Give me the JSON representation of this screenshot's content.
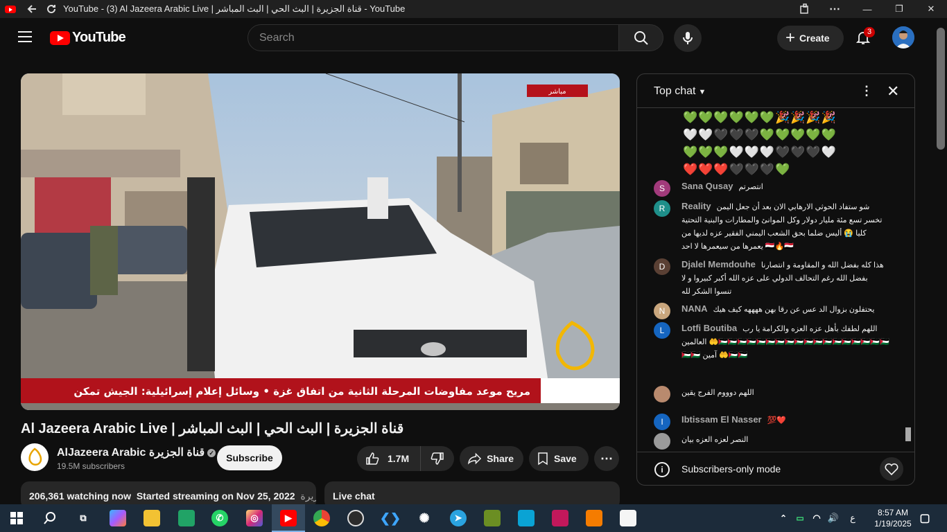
{
  "window": {
    "title": "YouTube - (3) Al Jazeera Arabic Live | قناة الجزيرة | البث الحي | البث المباشر - YouTube"
  },
  "masthead": {
    "logo_text": "YouTube",
    "search_placeholder": "Search",
    "create_label": "Create",
    "notification_count": "3"
  },
  "video": {
    "title": "Al Jazeera Arabic Live | قناة الجزيرة | البث الحي | البث المباشر",
    "ticker_text": "مريح موعد مفاوضات المرحلة الثانية من اتفاق غزة  •  وسائل إعلام إسرائيلية: الجيش تمكن",
    "live_badge": "مباشر"
  },
  "channel": {
    "name": "AlJazeera Arabic قناة الجزيرة",
    "subscribers": "19.5M subscribers",
    "subscribe_label": "Subscribe"
  },
  "actions": {
    "likes": "1.7M",
    "share_label": "Share",
    "save_label": "Save"
  },
  "description": {
    "watching": "206,361 watching now",
    "started": "Started streaming on Nov 25, 2022",
    "trail": "جزيرة"
  },
  "live_chat_label": "Live chat",
  "chat": {
    "title": "Top chat",
    "emoji_rows": [
      "💚💚💚💚💚💚🎉🎉🎉🎉",
      "🤍🤍🖤🖤🖤💚💚💚💚💚",
      "💚💚💚🤍🤍🤍🖤🖤🖤🤍",
      "❤️❤️❤️🖤🖤🖤💚"
    ],
    "messages": [
      {
        "initial": "S",
        "author": "Sana Qusay",
        "text": "انتصرتم",
        "color": "#a23a7b"
      },
      {
        "initial": "R",
        "author": "Reality",
        "text": "شو ستفاد الحوثي الارهابي الان بعد أن جعل اليمن تخسر تسع مئة مليار دولار وكل الموانئ والمطارات والبنية التحتية كليا 😭 أليس ضلما بحق الشعب اليمني الفقير عزه لديها من يعمرها من سيعمرها لا احد 🇾🇪🔥🇾🇪",
        "color": "#1e8f8a"
      },
      {
        "initial": "D",
        "author": "Djalel Memdouhe",
        "text": "هذا كله بفضل الله و المقاومة و انتصارنا بفضل الله رغم التحالف الدولي على عزه الله أكبر كبيروا و لا تنسوا الشكر لله",
        "color": "#5a4034"
      },
      {
        "initial": "N",
        "author": "NANA",
        "text": "يحتفلون بزوال الد عس عن رقا بهن ههههه كيف هيك",
        "color": "#c9a67d"
      },
      {
        "initial": "L",
        "author": "Lotfi Boutiba",
        "text": "اللهم لطفك بأهل عزه العزه والكرامة يا رب العالمين 🤲🇵🇸🇵🇸🇵🇸🇵🇸🇵🇸🇵🇸🇵🇸🇵🇸🇵🇸🇵🇸🇵🇸🇵🇸🇵🇸🇵🇸🇵🇸🇵🇸🇵🇸🇵🇸🇵🇸🇵🇸 آمين 🤲🇵🇸🇵🇸",
        "color": "#1565c0"
      },
      {
        "initial": "",
        "author": "",
        "text": "اللهم دوووم الفرج يقين",
        "color": "#b98a6e"
      },
      {
        "initial": "I",
        "author": "Ibtissam El Nasser",
        "text": "💯❤️",
        "color": "#1565c0"
      },
      {
        "initial": "",
        "author": "",
        "text": "النصر لعزه العزه بيان",
        "color": "#9a9a9a"
      }
    ],
    "footer_mode": "Subscribers-only mode"
  },
  "taskbar": {
    "time": "8:57 AM",
    "date": "1/19/2025",
    "lang": "ع"
  }
}
